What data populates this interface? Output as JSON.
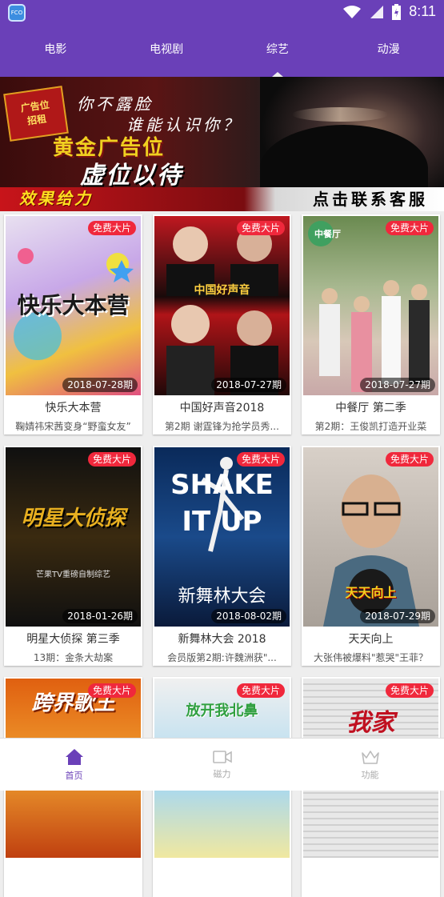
{
  "status_bar": {
    "app_badge_label": "FCO",
    "time": "8:11"
  },
  "tabs": [
    {
      "label": "电影",
      "active": false
    },
    {
      "label": "电视剧",
      "active": false
    },
    {
      "label": "综艺",
      "active": true
    },
    {
      "label": "动漫",
      "active": false
    }
  ],
  "banner": {
    "stamp_line1": "广告位",
    "stamp_line2": "招租",
    "line1": "你不露脸",
    "line2": "谁能认识你？",
    "line3": "黄金广告位",
    "line4": "虚位以待",
    "effect": "效果给力",
    "contact": "点击联系客服"
  },
  "cards": [
    {
      "badge": "免费大片",
      "episode": "2018-07-28期",
      "title": "快乐大本营",
      "subtitle": "鞠婧祎宋茜变身“野蛮女友”",
      "art_text": "快乐大本营"
    },
    {
      "badge": "免费大片",
      "episode": "2018-07-27期",
      "title": "中国好声音2018",
      "subtitle": "第2期 谢霆锋为抢学员秀...",
      "art_text": "中国好声音"
    },
    {
      "badge": "免费大片",
      "episode": "2018-07-27期",
      "title": "中餐厅 第二季",
      "subtitle": "第2期：王俊凯打造开业菜",
      "art_text": "中餐厅"
    },
    {
      "badge": "免费大片",
      "episode": "2018-01-26期",
      "title": "明星大侦探 第三季",
      "subtitle": "13期：金条大劫案",
      "art_text": "明星大侦探",
      "art_subtext": "芒果TV重磅自制综艺"
    },
    {
      "badge": "免费大片",
      "episode": "2018-08-02期",
      "title": "新舞林大会 2018",
      "subtitle": "会员版第2期:许魏洲获\"...",
      "art_text": "SHAKE IT UP",
      "art_subtext": "新舞林大会"
    },
    {
      "badge": "免费大片",
      "episode": "2018-07-29期",
      "title": "天天向上",
      "subtitle": "大张伟被爆料\"惹哭\"王菲？",
      "art_text": "天天向上"
    },
    {
      "badge": "免费大片",
      "episode": "",
      "title": "",
      "subtitle": "",
      "art_text": "跨界歌王"
    },
    {
      "badge": "免费大片",
      "episode": "",
      "title": "",
      "subtitle": "",
      "art_text": "放开我北鼻"
    },
    {
      "badge": "免费大片",
      "episode": "",
      "title": "",
      "subtitle": "",
      "art_text": "我家"
    }
  ],
  "bottom_nav": [
    {
      "label": "首页",
      "icon": "home-icon",
      "active": true
    },
    {
      "label": "磁力",
      "icon": "video-camera-icon",
      "active": false
    },
    {
      "label": "功能",
      "icon": "crown-icon",
      "active": false
    }
  ],
  "colors": {
    "primary": "#6a40b8",
    "badge": "#f0283c"
  }
}
